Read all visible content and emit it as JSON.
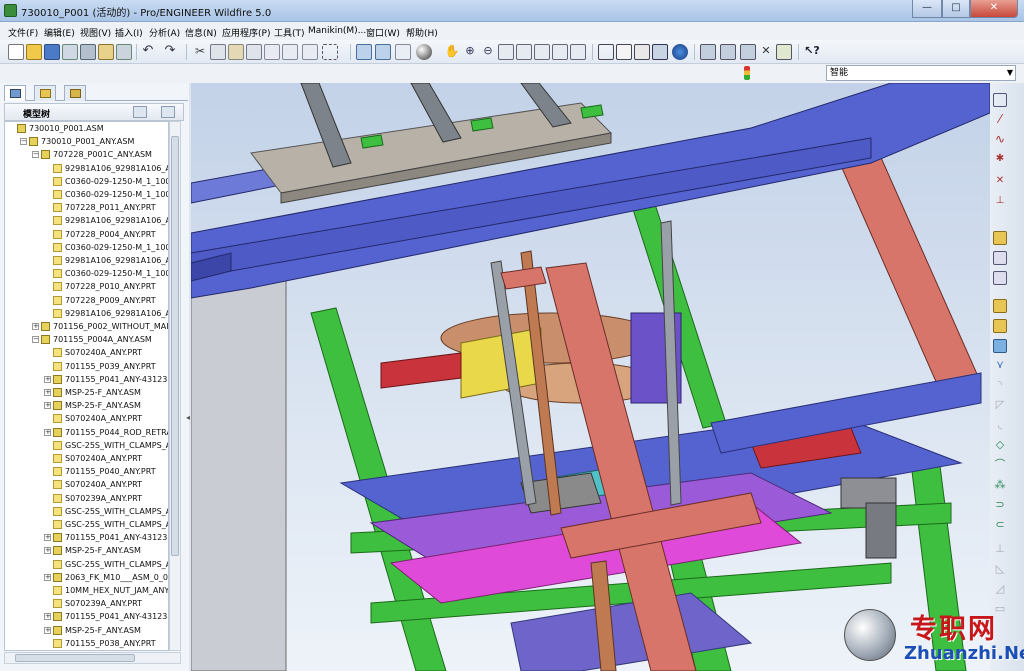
{
  "window": {
    "title": "730010_P001 (活动的) - Pro/ENGINEER Wildfire 5.0",
    "minimize": "—",
    "maximize": "□",
    "close": "✕"
  },
  "menu": [
    "文件(F)",
    "编辑(E)",
    "视图(V)",
    "插入(I)",
    "分析(A)",
    "信息(N)",
    "应用程序(P)",
    "工具(T)",
    "Manikin(M)...",
    "窗口(W)",
    "帮助(H)"
  ],
  "toolbar2": {
    "filter_value": "智能"
  },
  "model_tree": {
    "title": "模型树",
    "rows": [
      {
        "label": "730010_P001.ASM",
        "level": 0,
        "expander": "",
        "type": "asm"
      },
      {
        "label": "730010_P001_ANY.ASM",
        "level": 1,
        "expander": "−",
        "type": "asm"
      },
      {
        "label": "707228_P001C_ANY.ASM",
        "level": 2,
        "expander": "−",
        "type": "asm"
      },
      {
        "label": "92981A106_92981A106_AN",
        "level": 3,
        "expander": "",
        "type": "prt"
      },
      {
        "label": "C0360-029-1250-M_1_100",
        "level": 3,
        "expander": "",
        "type": "prt"
      },
      {
        "label": "C0360-029-1250-M_1_100",
        "level": 3,
        "expander": "",
        "type": "prt"
      },
      {
        "label": "707228_P011_ANY.PRT",
        "level": 3,
        "expander": "",
        "type": "prt"
      },
      {
        "label": "92981A106_92981A106_AN",
        "level": 3,
        "expander": "",
        "type": "prt"
      },
      {
        "label": "707228_P004_ANY.PRT",
        "level": 3,
        "expander": "",
        "type": "prt"
      },
      {
        "label": "C0360-029-1250-M_1_100",
        "level": 3,
        "expander": "",
        "type": "prt"
      },
      {
        "label": "92981A106_92981A106_AN",
        "level": 3,
        "expander": "",
        "type": "prt"
      },
      {
        "label": "C0360-029-1250-M_1_100",
        "level": 3,
        "expander": "",
        "type": "prt"
      },
      {
        "label": "707228_P010_ANY.PRT",
        "level": 3,
        "expander": "",
        "type": "prt"
      },
      {
        "label": "707228_P009_ANY.PRT",
        "level": 3,
        "expander": "",
        "type": "prt"
      },
      {
        "label": "92981A106_92981A106_AN",
        "level": 3,
        "expander": "",
        "type": "prt"
      },
      {
        "label": "701156_P002_WITHOUT_MAIN",
        "level": 2,
        "expander": "+",
        "type": "asm"
      },
      {
        "label": "701155_P004A_ANY.ASM",
        "level": 2,
        "expander": "−",
        "type": "asm"
      },
      {
        "label": "S070240A_ANY.PRT",
        "level": 3,
        "expander": "",
        "type": "prt"
      },
      {
        "label": "701155_P039_ANY.PRT",
        "level": 3,
        "expander": "",
        "type": "prt"
      },
      {
        "label": "701155_P041_ANY-431238",
        "level": 3,
        "expander": "+",
        "type": "asm"
      },
      {
        "label": "MSP-25-F_ANY.ASM",
        "level": 3,
        "expander": "+",
        "type": "asm"
      },
      {
        "label": "MSP-25-F_ANY.ASM",
        "level": 3,
        "expander": "+",
        "type": "asm"
      },
      {
        "label": "S070240A_ANY.PRT",
        "level": 3,
        "expander": "",
        "type": "prt"
      },
      {
        "label": "701155_P044_ROD_RETRA",
        "level": 3,
        "expander": "+",
        "type": "asm"
      },
      {
        "label": "GSC-25S_WITH_CLAMPS_A",
        "level": 3,
        "expander": "",
        "type": "prt"
      },
      {
        "label": "S070240A_ANY.PRT",
        "level": 3,
        "expander": "",
        "type": "prt"
      },
      {
        "label": "701155_P040_ANY.PRT",
        "level": 3,
        "expander": "",
        "type": "prt"
      },
      {
        "label": "S070240A_ANY.PRT",
        "level": 3,
        "expander": "",
        "type": "prt"
      },
      {
        "label": "S070239A_ANY.PRT",
        "level": 3,
        "expander": "",
        "type": "prt"
      },
      {
        "label": "GSC-25S_WITH_CLAMPS_A",
        "level": 3,
        "expander": "",
        "type": "prt"
      },
      {
        "label": "GSC-25S_WITH_CLAMPS_A",
        "level": 3,
        "expander": "",
        "type": "prt"
      },
      {
        "label": "701155_P041_ANY-431238",
        "level": 3,
        "expander": "+",
        "type": "asm"
      },
      {
        "label": "MSP-25-F_ANY.ASM",
        "level": 3,
        "expander": "+",
        "type": "asm"
      },
      {
        "label": "GSC-25S_WITH_CLAMPS_A",
        "level": 3,
        "expander": "",
        "type": "prt"
      },
      {
        "label": "2063_FK_M10___ASM_0_0",
        "level": 3,
        "expander": "+",
        "type": "asm"
      },
      {
        "label": "10MM_HEX_NUT_JAM_ANY",
        "level": 3,
        "expander": "",
        "type": "prt"
      },
      {
        "label": "S070239A_ANY.PRT",
        "level": 3,
        "expander": "",
        "type": "prt"
      },
      {
        "label": "701155_P041_ANY-431238",
        "level": 3,
        "expander": "+",
        "type": "asm"
      },
      {
        "label": "MSP-25-F_ANY.ASM",
        "level": 3,
        "expander": "+",
        "type": "asm"
      },
      {
        "label": "701155_P038_ANY.PRT",
        "level": 3,
        "expander": "",
        "type": "prt"
      }
    ]
  },
  "watermark": {
    "cn": "专职网",
    "en": "Zhuanzhi.Net"
  },
  "colors": {
    "frame_red": "#d8756a",
    "frame_green": "#3fbf3f",
    "plate_blue": "#5563d0",
    "plate_purple": "#9b5ad8",
    "magenta": "#e04ad8",
    "teal": "#4fc1c7"
  }
}
